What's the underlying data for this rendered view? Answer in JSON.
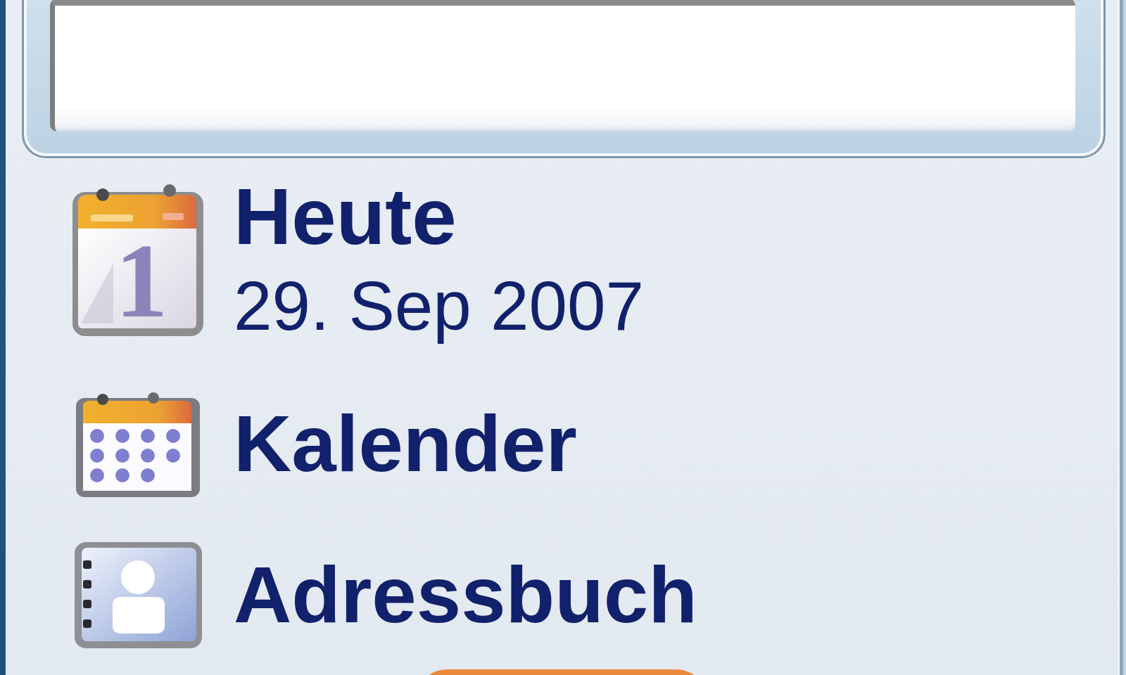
{
  "menu": {
    "items": [
      {
        "kind": "today",
        "label": "Heute",
        "detail": "29. Sep 2007",
        "icon_text": "1"
      },
      {
        "kind": "calendar",
        "label": "Kalender"
      },
      {
        "kind": "contacts",
        "label": "Adressbuch"
      }
    ]
  }
}
